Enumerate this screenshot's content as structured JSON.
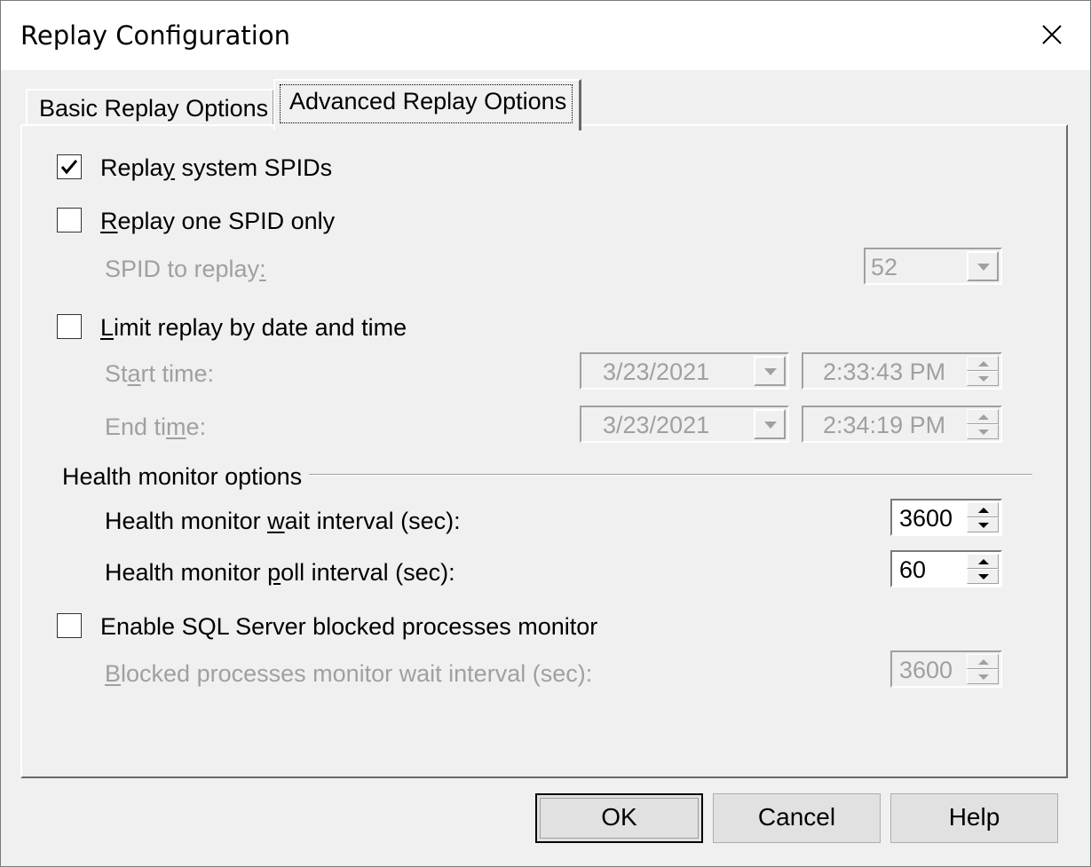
{
  "window": {
    "title": "Replay Configuration",
    "close_icon": "close-icon"
  },
  "tabs": [
    {
      "label": "Basic Replay Options",
      "selected": false
    },
    {
      "label": "Advanced Replay Options",
      "selected": true
    }
  ],
  "options": {
    "replay_system_spids": {
      "label_pre": "Repla",
      "label_ul": "y",
      "label_post": " system SPIDs",
      "checked": true
    },
    "replay_one_spid": {
      "label_ul": "R",
      "label_post": "eplay one SPID only",
      "checked": false
    },
    "spid_to_replay": {
      "label_pre": "SPID to replay",
      "label_ul": ":",
      "value": "52",
      "enabled": false
    },
    "limit_by_date": {
      "label_ul": "L",
      "label_post": "imit replay by date and time",
      "checked": false
    },
    "start_time": {
      "label_pre": "St",
      "label_ul": "a",
      "label_post": "rt time:",
      "date": "3/23/2021",
      "time": "2:33:43 PM"
    },
    "end_time": {
      "label_pre": "End ti",
      "label_ul": "m",
      "label_post": "e:",
      "date": "3/23/2021",
      "time": "2:34:19 PM"
    }
  },
  "health_monitor": {
    "group_label": "Health monitor options",
    "wait_interval": {
      "label_pre": "Health monitor ",
      "label_ul": "w",
      "label_post": "ait interval (sec):",
      "value": "3600"
    },
    "poll_interval": {
      "label_pre": "Health monitor ",
      "label_ul": "p",
      "label_post": "oll interval (sec):",
      "value": "60"
    }
  },
  "blocked": {
    "enable": {
      "label": "Enable SQL Server blocked processes monitor",
      "checked": false
    },
    "wait_interval": {
      "label_ul": "B",
      "label_post": "locked processes monitor wait interval (sec):",
      "value": "3600",
      "enabled": false
    }
  },
  "buttons": {
    "ok": "OK",
    "cancel": "Cancel",
    "help": "Help"
  }
}
